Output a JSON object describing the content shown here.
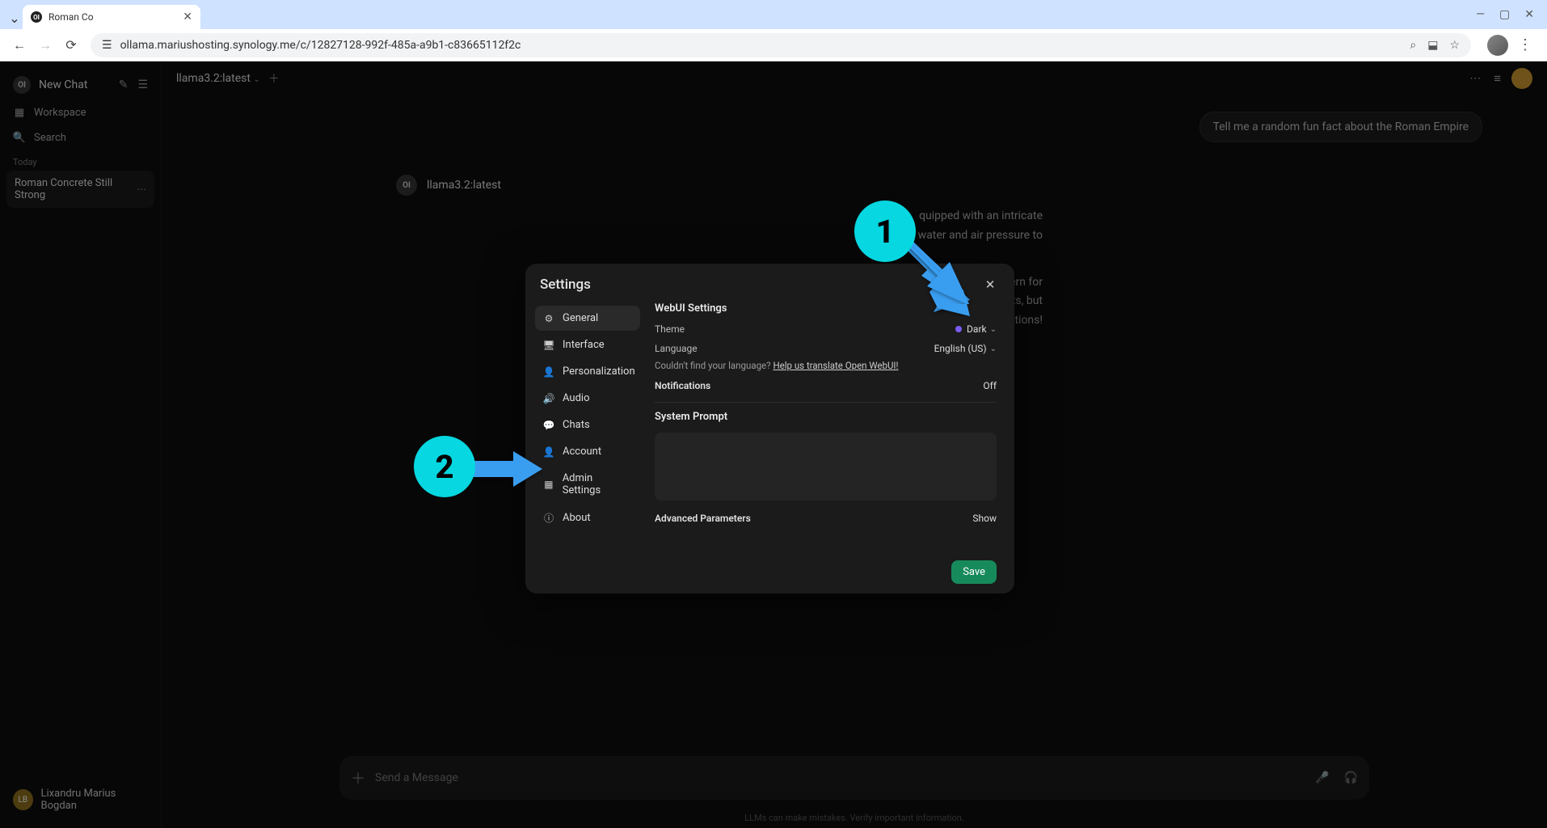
{
  "browser": {
    "tab_title": "Roman Co",
    "url": "ollama.mariushosting.synology.me/c/12827128-992f-485a-a9b1-c83665112f2c"
  },
  "sidebar": {
    "new_chat": "New Chat",
    "workspace": "Workspace",
    "search": "Search",
    "section": "Today",
    "chat_item": "Roman Concrete Still Strong",
    "user": "Lixandru Marius Bogdan",
    "user_initials": "LB"
  },
  "topbar": {
    "model": "llama3.2:latest"
  },
  "chat": {
    "user_message": "Tell me a random fun fact about the Roman Empire",
    "assistant_name": "llama3.2:latest",
    "assistant_body_1": "quipped with an intricate",
    "assistant_body_2": "water and air pressure to",
    "assistant_body_3": "hich was a major concern for",
    "assistant_body_4": "in Rome's public toilets, but",
    "assistant_body_5": "ivilizations!"
  },
  "composer": {
    "placeholder": "Send a Message",
    "footer": "LLMs can make mistakes. Verify important information."
  },
  "modal": {
    "title": "Settings",
    "nav": {
      "general": "General",
      "interface": "Interface",
      "personalization": "Personalization",
      "audio": "Audio",
      "chats": "Chats",
      "account": "Account",
      "admin": "Admin Settings",
      "about": "About"
    },
    "content": {
      "section_webui": "WebUI Settings",
      "theme_label": "Theme",
      "theme_value": "Dark",
      "language_label": "Language",
      "language_value": "English (US)",
      "lang_help_prefix": "Couldn't find your language? ",
      "lang_help_link": "Help us translate Open WebUI!",
      "notifications_label": "Notifications",
      "notifications_value": "Off",
      "system_prompt": "System Prompt",
      "advanced": "Advanced Parameters",
      "advanced_action": "Show",
      "save": "Save"
    }
  },
  "annotations": {
    "one": "1",
    "two": "2"
  }
}
